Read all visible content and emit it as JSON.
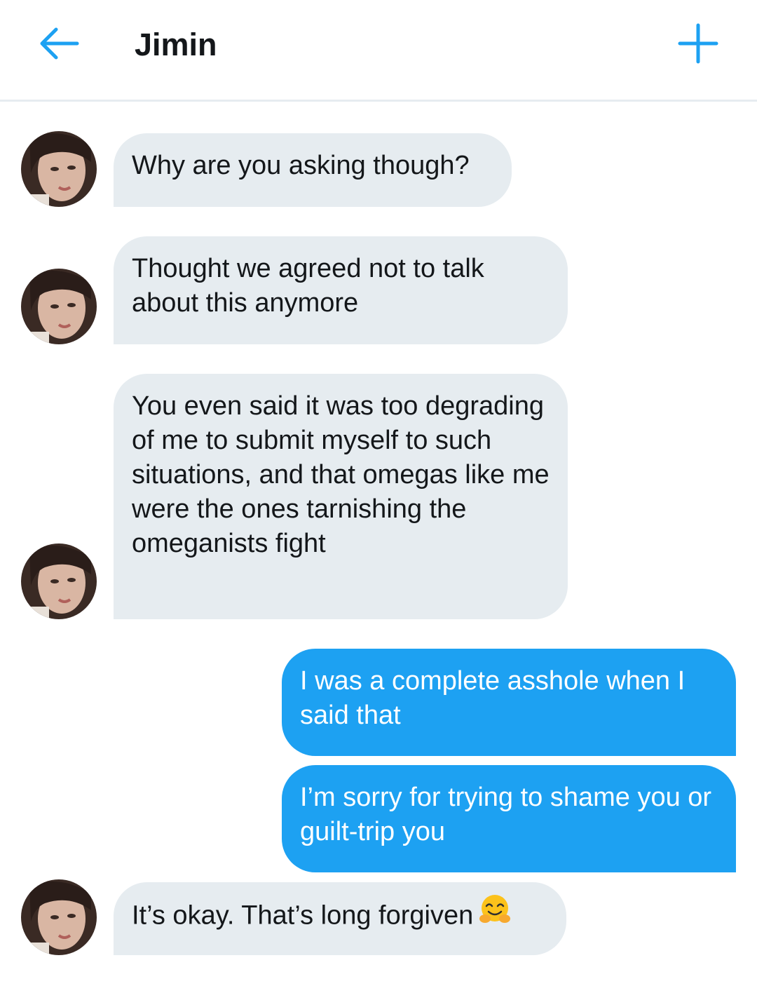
{
  "header": {
    "title": "Jimin",
    "back_icon": "arrow-left-icon",
    "new_icon": "plus-icon",
    "accent_color": "#1da1f2"
  },
  "messages": [
    {
      "direction": "incoming",
      "text": "Why are you asking though?"
    },
    {
      "direction": "incoming",
      "text": "Thought we agreed not to talk about this anymore"
    },
    {
      "direction": "incoming",
      "text": "You even said it was too degrading of me to submit myself to such situations, and that omegas like me were the ones tarnishing the omeganists fight"
    },
    {
      "direction": "outgoing",
      "text": "I was a complete asshole when I said that"
    },
    {
      "direction": "outgoing",
      "text": "I’m sorry for trying to shame you or guilt-trip you"
    },
    {
      "direction": "incoming",
      "text": "It’s okay. That’s long forgiven",
      "emoji": "hugging-face-emoji"
    }
  ],
  "colors": {
    "incoming_bubble": "#e6ecf0",
    "outgoing_bubble": "#1da1f2",
    "text_dark": "#14171a"
  }
}
